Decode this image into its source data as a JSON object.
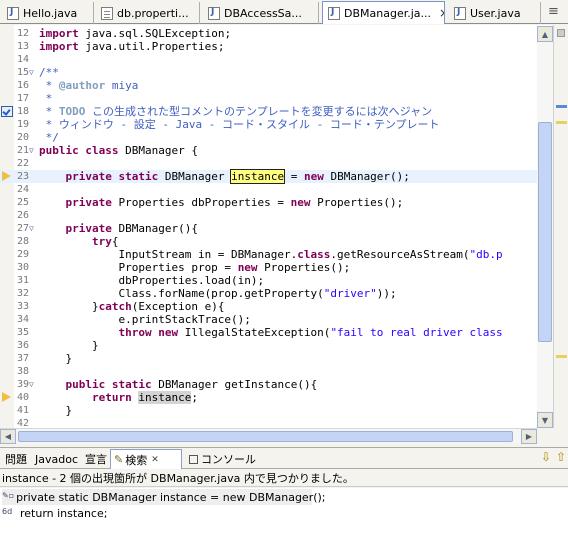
{
  "editor_tabs": [
    {
      "label": "Hello.java",
      "icon": "java-file-icon"
    },
    {
      "label": "db.properti...",
      "icon": "properties-file-icon"
    },
    {
      "label": "DBAccessSa...",
      "icon": "java-file-icon"
    },
    {
      "label": "DBManager.ja...",
      "icon": "java-file-icon",
      "active": true,
      "close": "×"
    },
    {
      "label": "User.java",
      "icon": "java-file-icon"
    }
  ],
  "overflow_glyph": "≡",
  "lines": [
    {
      "n": "12",
      "fold": "",
      "parts": [
        {
          "t": "import",
          "c": "kw"
        },
        {
          "t": " java.sql.SQLException;"
        }
      ]
    },
    {
      "n": "13",
      "fold": "",
      "parts": [
        {
          "t": "import",
          "c": "kw"
        },
        {
          "t": " java.util.Properties;"
        }
      ]
    },
    {
      "n": "14",
      "fold": "",
      "parts": [
        {
          "t": ""
        }
      ]
    },
    {
      "n": "15",
      "fold": "▽",
      "parts": [
        {
          "t": "/**",
          "c": "cm"
        }
      ]
    },
    {
      "n": "16",
      "fold": "",
      "parts": [
        {
          "t": " * ",
          "c": "cm"
        },
        {
          "t": "@author",
          "c": "tg"
        },
        {
          "t": " miya",
          "c": "cm"
        }
      ]
    },
    {
      "n": "17",
      "fold": "",
      "parts": [
        {
          "t": " *",
          "c": "cm"
        }
      ]
    },
    {
      "n": "18",
      "fold": "",
      "marker": "task",
      "parts": [
        {
          "t": " * ",
          "c": "cm"
        },
        {
          "t": "TODO",
          "c": "tg"
        },
        {
          "t": " この生成された型コメントのテンプレートを変更するには次へジャン",
          "c": "cm"
        }
      ]
    },
    {
      "n": "19",
      "fold": "",
      "parts": [
        {
          "t": " * ウィンドウ - 設定 - Java - コード・スタイル - コード・テンプレート",
          "c": "cm"
        }
      ]
    },
    {
      "n": "20",
      "fold": "",
      "parts": [
        {
          "t": " */",
          "c": "cm"
        }
      ]
    },
    {
      "n": "21",
      "fold": "▽",
      "parts": [
        {
          "t": "public",
          "c": "kw"
        },
        {
          "t": " "
        },
        {
          "t": "class",
          "c": "kw"
        },
        {
          "t": " DBManager {"
        }
      ]
    },
    {
      "n": "22",
      "fold": "",
      "parts": [
        {
          "t": ""
        }
      ]
    },
    {
      "n": "23",
      "fold": "",
      "marker": "arrow",
      "cur": true,
      "parts": [
        {
          "t": "    "
        },
        {
          "t": "private",
          "c": "kw"
        },
        {
          "t": " "
        },
        {
          "t": "static",
          "c": "kw"
        },
        {
          "t": " DBManager "
        },
        {
          "t": "instance",
          "c": "occw sel"
        },
        {
          "t": " = "
        },
        {
          "t": "new",
          "c": "kw"
        },
        {
          "t": " DBManager();"
        }
      ]
    },
    {
      "n": "24",
      "fold": "",
      "parts": [
        {
          "t": ""
        }
      ]
    },
    {
      "n": "25",
      "fold": "",
      "parts": [
        {
          "t": "    "
        },
        {
          "t": "private",
          "c": "kw"
        },
        {
          "t": " Properties dbProperties = "
        },
        {
          "t": "new",
          "c": "kw"
        },
        {
          "t": " Properties();"
        }
      ]
    },
    {
      "n": "26",
      "fold": "",
      "parts": [
        {
          "t": ""
        }
      ]
    },
    {
      "n": "27",
      "fold": "▽",
      "parts": [
        {
          "t": "    "
        },
        {
          "t": "private",
          "c": "kw"
        },
        {
          "t": " DBManager(){"
        }
      ]
    },
    {
      "n": "28",
      "fold": "",
      "parts": [
        {
          "t": "        "
        },
        {
          "t": "try",
          "c": "kw"
        },
        {
          "t": "{"
        }
      ]
    },
    {
      "n": "29",
      "fold": "",
      "parts": [
        {
          "t": "            InputStream in = DBManager."
        },
        {
          "t": "class",
          "c": "kw"
        },
        {
          "t": ".getResourceAsStream("
        },
        {
          "t": "\"db.p",
          "c": "st"
        }
      ]
    },
    {
      "n": "30",
      "fold": "",
      "parts": [
        {
          "t": "            Properties prop = "
        },
        {
          "t": "new",
          "c": "kw"
        },
        {
          "t": " Properties();"
        }
      ]
    },
    {
      "n": "31",
      "fold": "",
      "parts": [
        {
          "t": "            dbProperties.load(in);"
        }
      ]
    },
    {
      "n": "32",
      "fold": "",
      "parts": [
        {
          "t": "            Class.forName(prop.getProperty("
        },
        {
          "t": "\"driver\"",
          "c": "st"
        },
        {
          "t": "));"
        }
      ]
    },
    {
      "n": "33",
      "fold": "",
      "parts": [
        {
          "t": "        }"
        },
        {
          "t": "catch",
          "c": "kw"
        },
        {
          "t": "(Exception e){"
        }
      ]
    },
    {
      "n": "34",
      "fold": "",
      "parts": [
        {
          "t": "            e.printStackTrace();"
        }
      ]
    },
    {
      "n": "35",
      "fold": "",
      "parts": [
        {
          "t": "            "
        },
        {
          "t": "throw",
          "c": "kw"
        },
        {
          "t": " "
        },
        {
          "t": "new",
          "c": "kw"
        },
        {
          "t": " IllegalStateException("
        },
        {
          "t": "\"fail to real driver class",
          "c": "st"
        }
      ]
    },
    {
      "n": "36",
      "fold": "",
      "parts": [
        {
          "t": "        }"
        }
      ]
    },
    {
      "n": "37",
      "fold": "",
      "parts": [
        {
          "t": "    }"
        }
      ]
    },
    {
      "n": "38",
      "fold": "",
      "parts": [
        {
          "t": ""
        }
      ]
    },
    {
      "n": "39",
      "fold": "▽",
      "parts": [
        {
          "t": "    "
        },
        {
          "t": "public",
          "c": "kw"
        },
        {
          "t": " "
        },
        {
          "t": "static",
          "c": "kw"
        },
        {
          "t": " DBManager getInstance(){"
        }
      ]
    },
    {
      "n": "40",
      "fold": "",
      "marker": "arrow",
      "parts": [
        {
          "t": "        "
        },
        {
          "t": "return",
          "c": "kw"
        },
        {
          "t": " "
        },
        {
          "t": "instance",
          "c": "occ"
        },
        {
          "t": ";"
        }
      ]
    },
    {
      "n": "41",
      "fold": "",
      "parts": [
        {
          "t": "    }"
        }
      ]
    },
    {
      "n": "42",
      "fold": "",
      "parts": [
        {
          "t": ""
        }
      ]
    }
  ],
  "bottom_tabs": [
    {
      "label": "問題"
    },
    {
      "label": "Javadoc"
    },
    {
      "label": "宣言"
    },
    {
      "label": "検索",
      "active": true,
      "close": "✕"
    },
    {
      "label": "コンソール"
    }
  ],
  "status_text": "instance - 2 個の出現箇所が DBManager.java 内で見つかりました。",
  "results": [
    {
      "label": "private static DBManager instance = new DBManager();",
      "icon": "write-occurrence-icon"
    },
    {
      "label": "return instance;",
      "icon": "read-occurrence-icon",
      "icon_text": "6d"
    }
  ],
  "toolbar": {
    "next": "⇩",
    "prev": "⇧"
  }
}
